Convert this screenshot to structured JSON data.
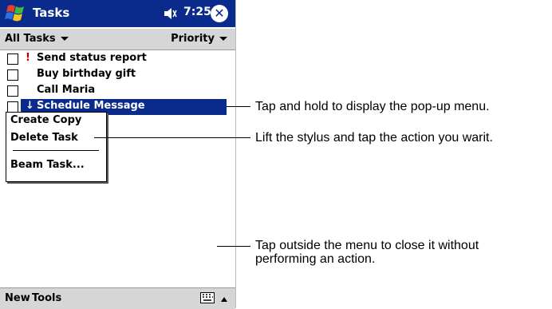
{
  "titlebar": {
    "app_title": "Tasks",
    "time": "7:25",
    "close": "ok"
  },
  "filterbar": {
    "category": "All Tasks",
    "sort": "Priority"
  },
  "tasks": [
    {
      "priority": "!",
      "label": "Send status report"
    },
    {
      "priority": "",
      "label": "Buy birthday gift"
    },
    {
      "priority": "",
      "label": "Call Maria"
    },
    {
      "priority": "↓",
      "label": "Schedule Message"
    }
  ],
  "popup_menu": {
    "items": [
      "Create Copy",
      "Delete Task",
      "Beam Task..."
    ]
  },
  "bottombar": {
    "new_label": "New",
    "tools_label": "Tools"
  },
  "callouts": {
    "hold": "Tap and hold to display the pop-up menu.",
    "lift": "Lift the stylus and tap the action you warit.",
    "outside_line1": "Tap outside the menu to close it without",
    "outside_line2": "performing an action."
  },
  "colors": {
    "titlebar": "#0a2a8c",
    "bars": "#d6d6d6",
    "selection": "#0a2a8c",
    "priority_high": "#c00000"
  },
  "icons": [
    "windows-start-icon",
    "speaker-icon",
    "close-icon",
    "keyboard-icon",
    "up-arrow-icon"
  ]
}
